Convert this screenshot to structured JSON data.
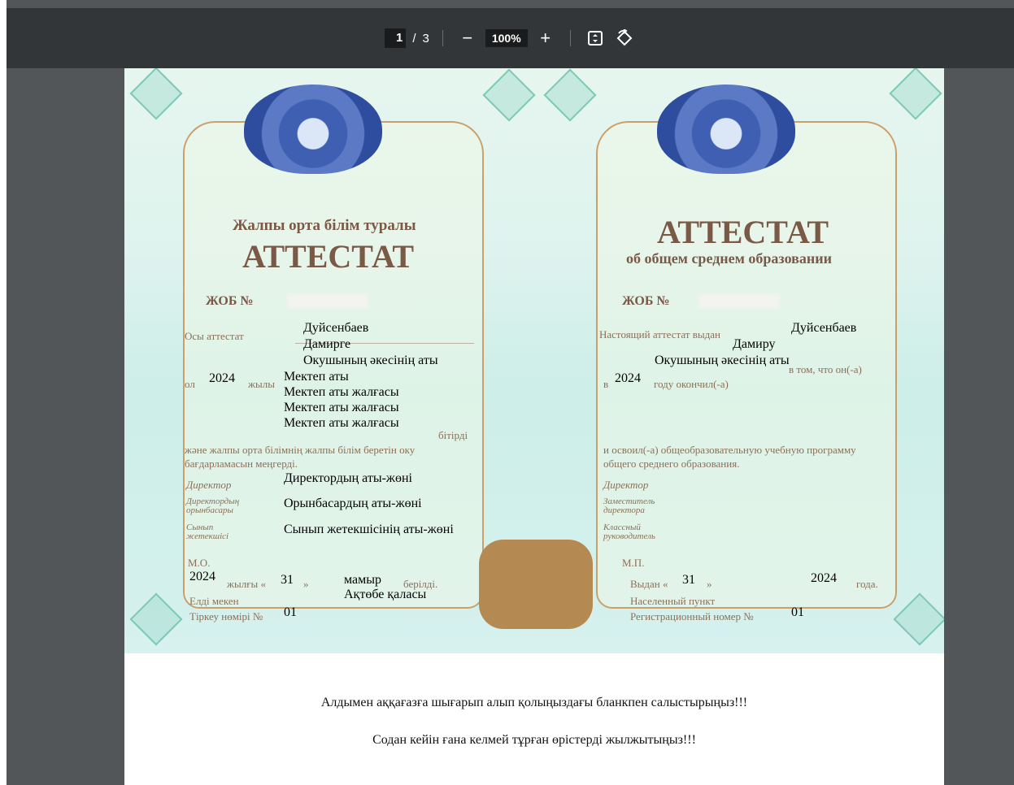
{
  "toolbar": {
    "page_current": "1",
    "page_separator": "/",
    "page_total": "3",
    "zoom_out": "−",
    "zoom_level": "100%",
    "zoom_in": "+",
    "fit_icon": "fit-page-icon",
    "rotate_icon": "rotate-icon"
  },
  "certificate": {
    "left": {
      "subtitle": "Жалпы орта білім туралы",
      "title": "АТТЕСТАТ",
      "number_label": "ЖОБ №",
      "issued_label": "Осы аттестат",
      "surname": "Дуйсенбаев",
      "name": "Дамирге",
      "patronymic": "Окушының әкесінің аты",
      "year_label_pre": "ол",
      "year": "2024",
      "year_label_post": "жылы",
      "school_1": "Мектеп аты",
      "school_2": "Мектеп аты жалғасы",
      "school_3": "Мектеп аты жалғасы",
      "school_4": "Мектеп аты жалғасы",
      "bitirdi": "бітірді",
      "program_1": "және жалпы орта білімнің жалпы білім беретін оку",
      "program_2": "бағдарламасын меңгерді.",
      "director_label": "Директор",
      "director_name": "Директордың аты-жөні",
      "deputy_label_1": "Директордың",
      "deputy_label_2": "орынбасары",
      "deputy_name": "Орынбасардың аты-жөні",
      "class_label_1": "Сынып",
      "class_label_2": "жетекшісі",
      "class_name": "Сынып жетекшісінің аты-жөні",
      "mo": "М.О.",
      "issue_year": "2024",
      "issue_year_label": "жылғы «",
      "issue_day": "31",
      "issue_day_close": "»",
      "issue_month": "мамыр",
      "issued_word": "берілді.",
      "locality_label": "Елді мекен",
      "locality": "Ақтөбе қаласы",
      "reg_label": "Тіркеу нөмірі №",
      "reg_number": "01"
    },
    "right": {
      "title": "АТТЕСТАТ",
      "subtitle": "об общем среднем образовании",
      "number_label": "ЖОБ №",
      "issued_label": "Настоящий аттестат выдан",
      "surname": "Дуйсенбаев",
      "name": "Дамиру",
      "patronymic": "Окушының әкесінің аты",
      "in_that": "в том, что он(-а)",
      "year_label_pre": "в",
      "year": "2024",
      "year_label_post": "году окончил(-а)",
      "program_1": "и освоил(-а) общеобразовательную учебную программу",
      "program_2": "общего среднего образования.",
      "director_label": "Директор",
      "deputy_label_1": "Заместитель",
      "deputy_label_2": "директора",
      "class_label_1": "Классный",
      "class_label_2": "руководитель",
      "mp": "М.П.",
      "issued_label_2": "Выдан «",
      "issue_day": "31",
      "issue_day_close": "»",
      "issue_year": "2024",
      "year_word": "года.",
      "locality_label": "Населенный пункт",
      "reg_label": "Регистрационный номер №",
      "reg_number": "01"
    }
  },
  "notes": {
    "line1": "Алдымен аққағазға шығарып алып қолыңыздағы бланкпен салыстырыңыз!!!",
    "line2": "Содан кейін ғана келмей тұрған өрістерді жылжытыңыз!!!"
  }
}
